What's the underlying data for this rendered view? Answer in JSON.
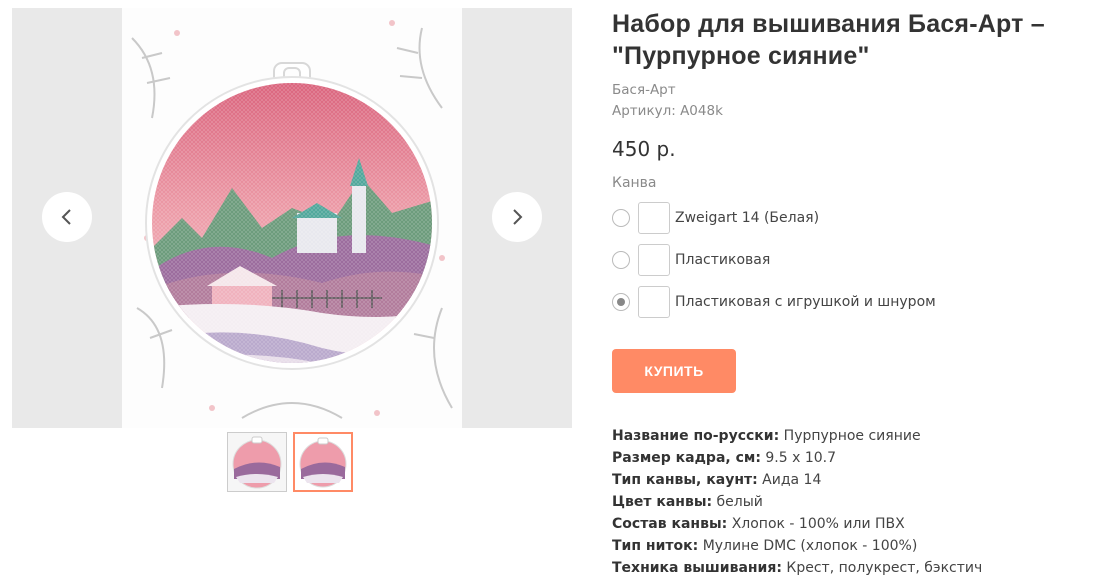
{
  "product": {
    "title": "Набор для вышивания Бася-Арт – \"Пурпурное сияние\"",
    "brand": "Бася-Арт",
    "sku_label": "Артикул:",
    "sku_value": "A048k",
    "price": "450 р."
  },
  "gallery": {
    "prev_icon": "chevron-left-icon",
    "next_icon": "chevron-right-icon",
    "thumbnails_count": 2,
    "active_thumbnail": 2
  },
  "canvas_option": {
    "label": "Канва",
    "options": [
      {
        "label": "Zweigart 14 (Белая)",
        "selected": false
      },
      {
        "label": "Пластиковая",
        "selected": false
      },
      {
        "label": "Пластиковая с игрушкой и шнуром",
        "selected": true
      }
    ]
  },
  "buy_button": {
    "label": "КУПИТЬ"
  },
  "specs": [
    {
      "key": "Название по-русски:",
      "value": "Пурпурное сияние"
    },
    {
      "key": "Размер кадра, см:",
      "value": "9.5 x 10.7"
    },
    {
      "key": "Тип канвы, каунт:",
      "value": "Аида 14"
    },
    {
      "key": "Цвет канвы:",
      "value": "белый"
    },
    {
      "key": "Состав канвы:",
      "value": "Хлопок - 100% или ПВХ"
    },
    {
      "key": "Тип ниток:",
      "value": "Мулине DMC (хлопок - 100%)"
    },
    {
      "key": "Техника вышивания:",
      "value": "Крест, полукрест, бэкстич"
    }
  ],
  "colors": {
    "accent": "#ff8a65",
    "gallery_bg": "#e9e9e9",
    "ornament_pink": "#e89aa8"
  }
}
